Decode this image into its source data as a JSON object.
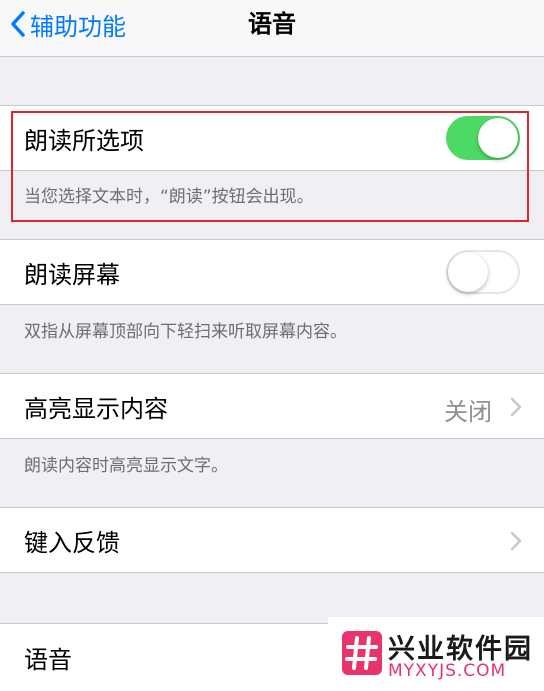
{
  "nav": {
    "back_label": "辅助功能",
    "title": "语音"
  },
  "speak_selection": {
    "label": "朗读所选项",
    "toggle_on": true,
    "footer": "当您选择文本时，“朗读”按钮会出现。"
  },
  "speak_screen": {
    "label": "朗读屏幕",
    "toggle_on": false,
    "footer": "双指从屏幕顶部向下轻扫来听取屏幕内容。"
  },
  "highlight_content": {
    "label": "高亮显示内容",
    "value": "关闭",
    "footer": "朗读内容时高亮显示文字。"
  },
  "typing_feedback": {
    "label": "键入反馈"
  },
  "voices": {
    "label": "语音"
  },
  "watermark": {
    "title": "兴业软件园",
    "url": "MYXYJS.COM"
  },
  "colors": {
    "accent": "#007aff",
    "toggle_on": "#4cd964",
    "highlight_border": "#e0262d",
    "watermark_pink": "#e8336b"
  },
  "icons": {
    "back": "chevron-left-icon",
    "disclosure": "chevron-right-icon",
    "logo": "hash-logo-icon"
  }
}
